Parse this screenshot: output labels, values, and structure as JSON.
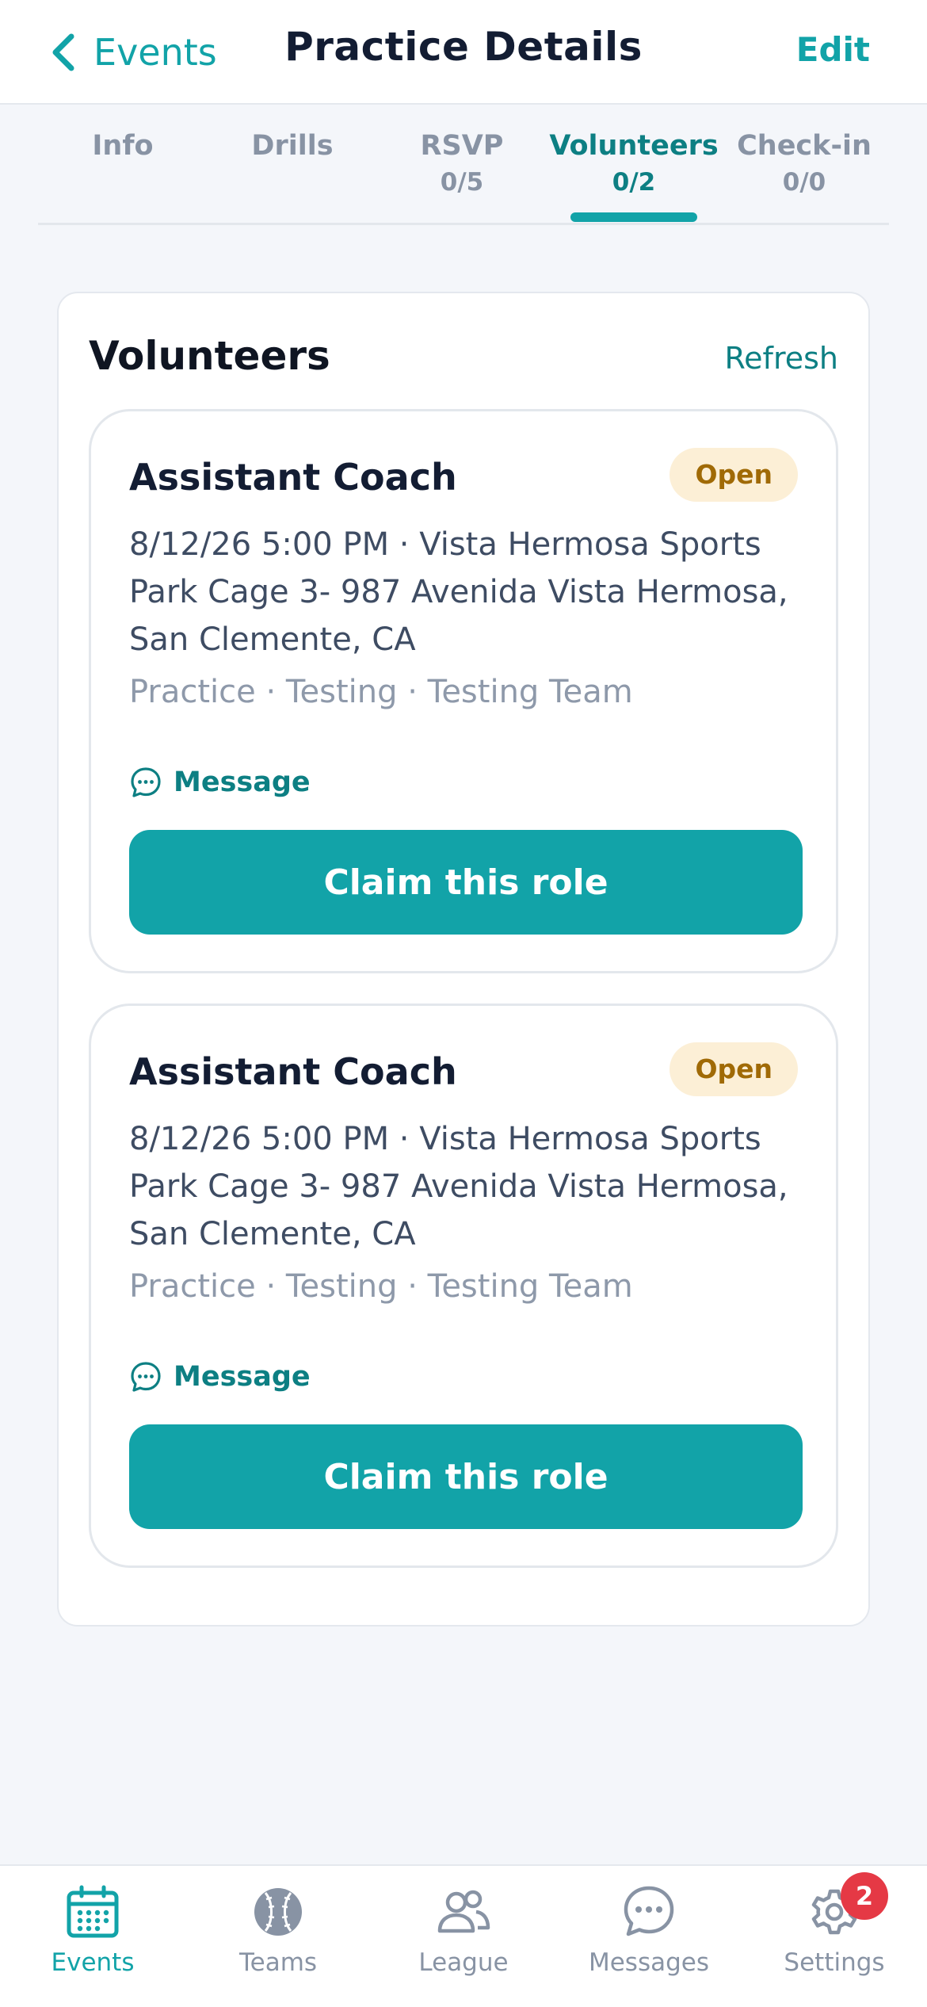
{
  "header": {
    "back_label": "Events",
    "title": "Practice Details",
    "edit_label": "Edit"
  },
  "tabs": [
    {
      "label": "Info",
      "count": ""
    },
    {
      "label": "Drills",
      "count": ""
    },
    {
      "label": "RSVP",
      "count": "0/5"
    },
    {
      "label": "Volunteers",
      "count": "0/2"
    },
    {
      "label": "Check-in",
      "count": "0/0"
    }
  ],
  "active_tab": "Volunteers",
  "panel": {
    "title": "Volunteers",
    "refresh_label": "Refresh"
  },
  "roles": [
    {
      "name": "Assistant Coach",
      "status": "Open",
      "details": "8/12/26 5:00 PM · Vista Hermosa Sports Park Cage 3- 987 Avenida Vista Hermosa, San Clemente, CA",
      "meta": "Practice · Testing · Testing Team",
      "message_label": "Message",
      "claim_label": "Claim this role"
    },
    {
      "name": "Assistant Coach",
      "status": "Open",
      "details": "8/12/26 5:00 PM · Vista Hermosa Sports Park Cage 3- 987 Avenida Vista Hermosa, San Clemente, CA",
      "meta": "Practice · Testing · Testing Team",
      "message_label": "Message",
      "claim_label": "Claim this role"
    }
  ],
  "bottom_nav": {
    "items": [
      {
        "label": "Events",
        "icon": "calendar-icon"
      },
      {
        "label": "Teams",
        "icon": "baseball-icon"
      },
      {
        "label": "League",
        "icon": "people-icon"
      },
      {
        "label": "Messages",
        "icon": "chat-bubble-icon"
      },
      {
        "label": "Settings",
        "icon": "gear-icon",
        "badge": "2"
      }
    ],
    "active": "Events"
  },
  "colors": {
    "accent": "#12a3a8",
    "accent_dark": "#0d7f83",
    "badge_open_bg": "#fcefd6",
    "badge_open_text": "#a06a06",
    "notification": "#e53945",
    "background": "#f4f6fa"
  }
}
